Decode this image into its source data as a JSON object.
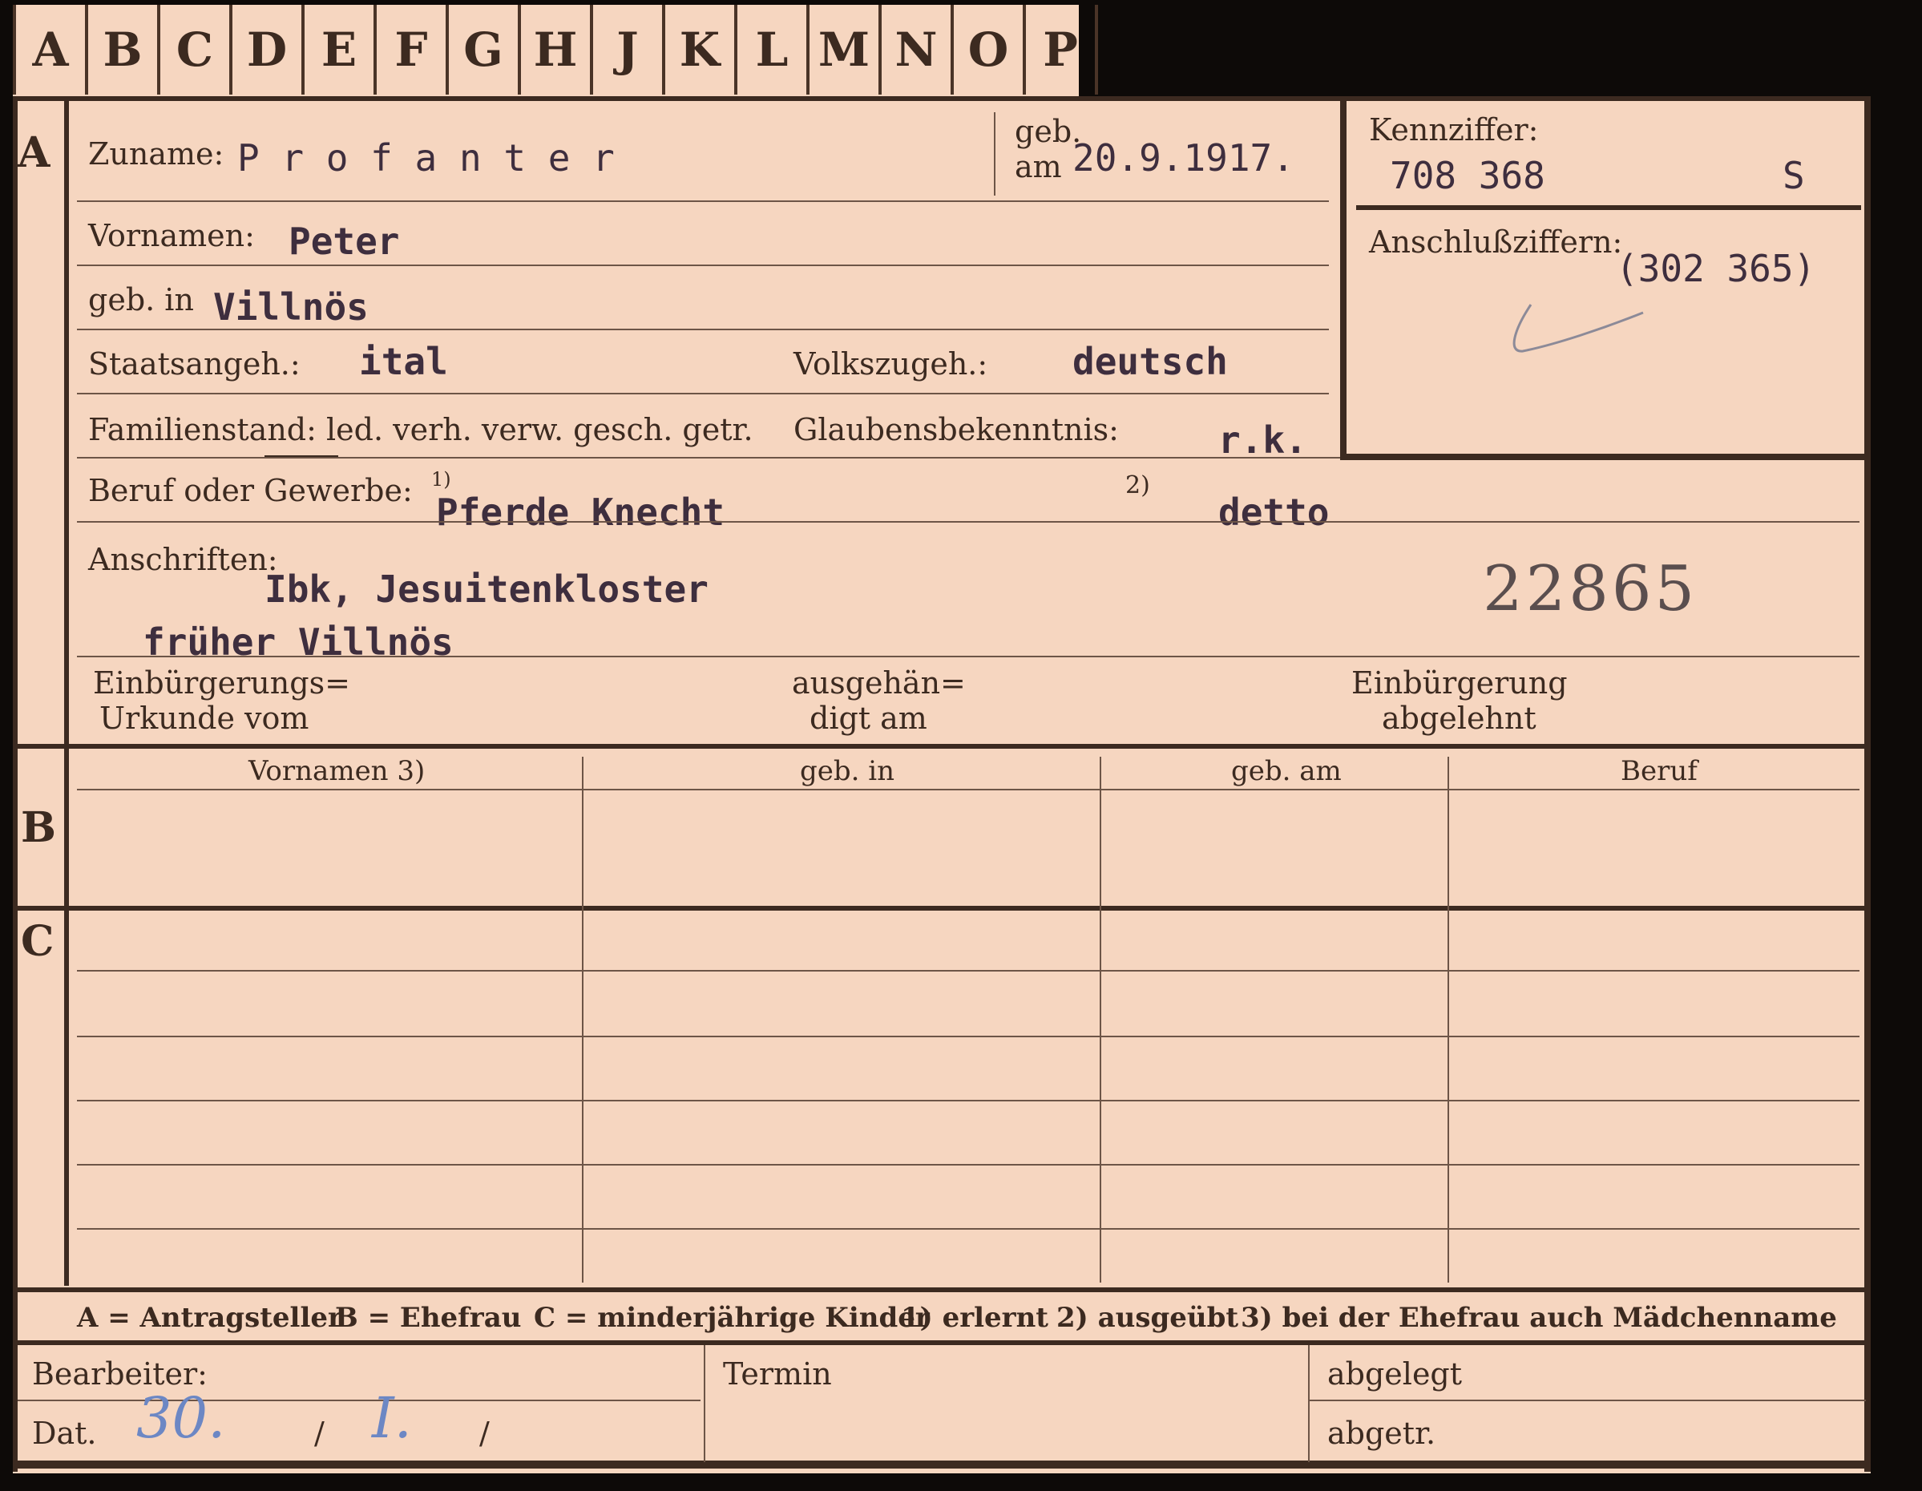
{
  "tabs": [
    "A",
    "B",
    "C",
    "D",
    "E",
    "F",
    "G",
    "H",
    "J",
    "K",
    "L",
    "M",
    "N",
    "O",
    "P"
  ],
  "sections": {
    "a": "A",
    "b": "B",
    "c": "C"
  },
  "fields": {
    "zuname_label": "Zuname:",
    "zuname_value": "P r o f a n t e r",
    "geb_am_label_top": "geb.",
    "geb_am_label_bottom": "am",
    "geb_am_value": "20.9.1917.",
    "kennziffer_label": "Kennziffer:",
    "kennziffer_value": "708 368",
    "kennziffer_suffix": "S",
    "anschluss_label": "Anschlußziffern:",
    "anschluss_value": "(302 365)",
    "vornamen_label": "Vornamen:",
    "vornamen_value": "Peter",
    "geb_in_label": "geb. in",
    "geb_in_value": "Villnös",
    "staatsangeh_label": "Staatsangeh.:",
    "staatsangeh_value": "ital",
    "volkszugeh_label": "Volkszugeh.:",
    "volkszugeh_value": "deutsch",
    "familienstand_label": "Familienstand: led. verh. verw. gesch. getr.",
    "glaubens_label": "Glaubensbekenntnis:",
    "glaubens_value": "r.k.",
    "beruf_label": "Beruf oder Gewerbe:",
    "beruf_note1": "1)",
    "beruf_value1": "Pferde Knecht",
    "beruf_note2": "2)",
    "beruf_value2": "detto",
    "anschriften_label": "Anschriften:",
    "anschriften_line1": "Ibk, Jesuitenkloster",
    "anschriften_line2": "früher Villnös",
    "stamp_number": "22865",
    "einb_urkunde_1": "Einbürgerungs=",
    "einb_urkunde_2": "Urkunde vom",
    "ausgehaen_1": "ausgehän=",
    "ausgehaen_2": "digt am",
    "einb_abgelehnt_1": "Einbürgerung",
    "einb_abgelehnt_2": "abgelehnt"
  },
  "table_b": {
    "columns": [
      "Vornamen 3)",
      "geb. in",
      "geb. am",
      "Beruf"
    ]
  },
  "footer_legend": {
    "a": "A = Antragsteller",
    "b": "B = Ehefrau",
    "c": "C = minderjährige Kinder",
    "n1": "1) erlernt",
    "n2": "2) ausgeübt",
    "n3": "3) bei der Ehefrau auch Mädchenname"
  },
  "bottom": {
    "bearbeiter_label": "Bearbeiter:",
    "dat_label": "Dat.",
    "dat_day": "30.",
    "dat_sep1": "/",
    "dat_month": "I.",
    "dat_sep2": "/",
    "termin_label": "Termin",
    "abgelegt_label": "abgelegt",
    "abgetr_label": "abgetr."
  },
  "colors": {
    "paper": "#f6d6c0",
    "ink": "#3c2a20",
    "type": "#3e2e3e",
    "pencil": "#6c87c4"
  }
}
